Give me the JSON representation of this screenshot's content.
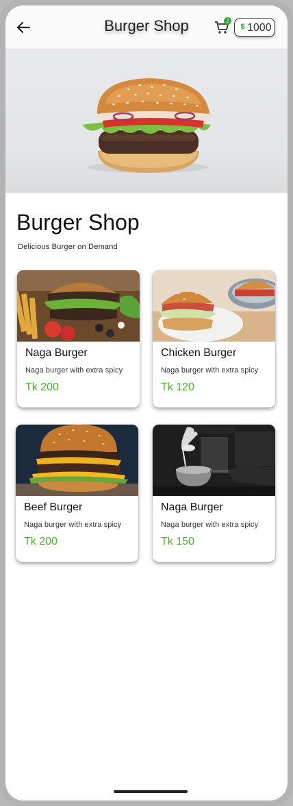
{
  "app_bar": {
    "title": "Burger Shop",
    "back_icon": "arrow-left-icon",
    "cart_icon": "cart-icon",
    "cart_count": "2",
    "coin_icon": "coin-icon",
    "coin_symbol": "$",
    "coin_balance": "1000"
  },
  "hero": {
    "image": "burger-photo"
  },
  "shop": {
    "title": "Burger Shop",
    "subtitle": "Delicious Burger on Demand"
  },
  "products": [
    {
      "name": "Naga Burger",
      "description": "Naga burger with extra spicy",
      "price": "Tk 200",
      "image": "loaded-burger-with-fries"
    },
    {
      "name": "Chicken Burger",
      "description": "Naga burger with extra spicy",
      "price": "Tk 120",
      "image": "chicken-burger-on-plate"
    },
    {
      "name": "Beef Burger",
      "description": "Naga burger with extra spicy",
      "price": "Tk 200",
      "image": "double-beef-cheese-burger"
    },
    {
      "name": "Naga Burger",
      "description": "Naga burger with extra spicy",
      "price": "Tk 150",
      "image": "chef-pouring-sauce"
    }
  ],
  "colors": {
    "accent_green": "#4cae2a",
    "badge_green": "#2ea82e",
    "app_bar_bg": "#fbfbfb"
  }
}
